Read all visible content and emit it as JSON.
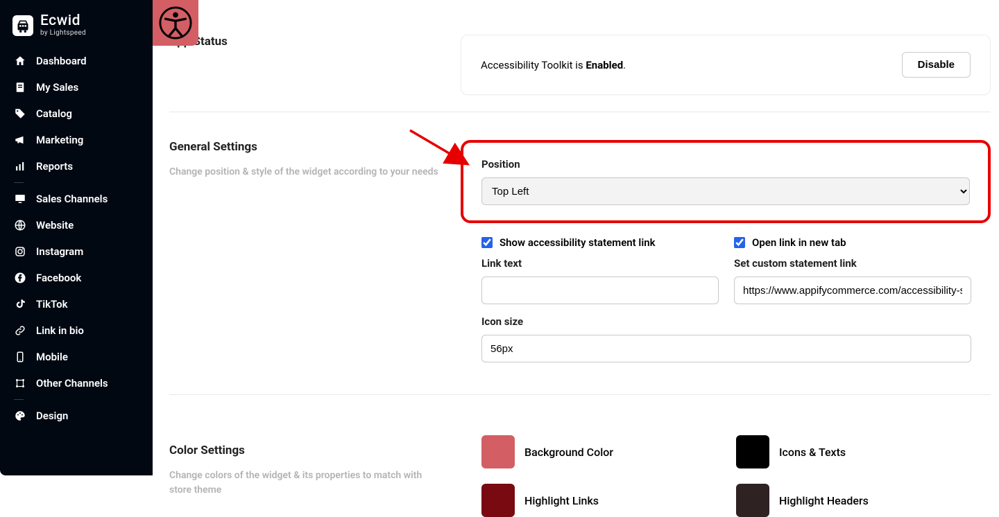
{
  "brand": {
    "title": "Ecwid",
    "subtitle": "by Lightspeed"
  },
  "sidebar": {
    "items": [
      {
        "id": "dashboard",
        "label": "Dashboard",
        "icon": "home"
      },
      {
        "id": "mysales",
        "label": "My Sales",
        "icon": "receipt"
      },
      {
        "id": "catalog",
        "label": "Catalog",
        "icon": "tag"
      },
      {
        "id": "marketing",
        "label": "Marketing",
        "icon": "megaphone"
      },
      {
        "id": "reports",
        "label": "Reports",
        "icon": "chart"
      }
    ],
    "items2": [
      {
        "id": "saleschannels",
        "label": "Sales Channels",
        "icon": "monitor"
      },
      {
        "id": "website",
        "label": "Website",
        "icon": "globe"
      },
      {
        "id": "instagram",
        "label": "Instagram",
        "icon": "instagram"
      },
      {
        "id": "facebook",
        "label": "Facebook",
        "icon": "facebook"
      },
      {
        "id": "tiktok",
        "label": "TikTok",
        "icon": "tiktok"
      },
      {
        "id": "linkinbio",
        "label": "Link in bio",
        "icon": "link"
      },
      {
        "id": "mobile",
        "label": "Mobile",
        "icon": "mobile"
      },
      {
        "id": "otherchannels",
        "label": "Other Channels",
        "icon": "channels"
      }
    ],
    "items3": [
      {
        "id": "design",
        "label": "Design",
        "icon": "palette"
      }
    ]
  },
  "sections": {
    "appStatus": {
      "title": "App Status",
      "text_prefix": "Accessibility Toolkit is ",
      "text_status": "Enabled",
      "text_suffix": ".",
      "button": "Disable"
    },
    "general": {
      "title": "General Settings",
      "desc": "Change position & style of the widget according to your needs",
      "position_label": "Position",
      "position_value": "Top Left",
      "show_link_label": "Show accessibility statement link",
      "open_new_tab_label": "Open link in new tab",
      "link_text_label": "Link text",
      "link_text_value": "",
      "custom_link_label": "Set custom statement link",
      "custom_link_value": "https://www.appifycommerce.com/accessibility-st",
      "icon_size_label": "Icon size",
      "icon_size_value": "56px"
    },
    "color": {
      "title": "Color Settings",
      "desc": "Change colors of the widget & its properties to match with store theme",
      "items": [
        {
          "label": "Background Color",
          "hex": "#d35e64"
        },
        {
          "label": "Icons & Texts",
          "hex": "#000000"
        },
        {
          "label": "Highlight Links",
          "hex": "#7a0a11"
        },
        {
          "label": "Highlight Headers",
          "hex": "#2f2222"
        }
      ]
    }
  }
}
